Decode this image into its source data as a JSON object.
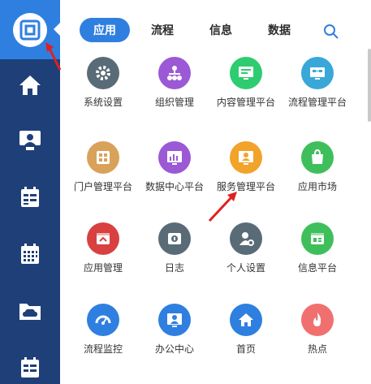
{
  "tabs": [
    {
      "label": "应用",
      "active": true
    },
    {
      "label": "流程",
      "active": false
    },
    {
      "label": "信息",
      "active": false
    },
    {
      "label": "数据",
      "active": false
    }
  ],
  "apps": [
    {
      "label": "系统设置",
      "color": "#5a6b78",
      "icon": "gear-icon"
    },
    {
      "label": "组织管理",
      "color": "#9b59d6",
      "icon": "org-chart-icon"
    },
    {
      "label": "内容管理平台",
      "color": "#2ecc71",
      "icon": "monitor-icon"
    },
    {
      "label": "流程管理平台",
      "color": "#3aa7d9",
      "icon": "flow-icon"
    },
    {
      "label": "门户管理平台",
      "color": "#d9a25b",
      "icon": "grid-icon"
    },
    {
      "label": "数据中心平台",
      "color": "#9b59d6",
      "icon": "bar-chart-icon"
    },
    {
      "label": "服务管理平台",
      "color": "#f2a32a",
      "icon": "service-icon"
    },
    {
      "label": "应用市场",
      "color": "#3fbf5b",
      "icon": "shopping-bag-icon"
    },
    {
      "label": "应用管理",
      "color": "#d94040",
      "icon": "app-window-icon"
    },
    {
      "label": "日志",
      "color": "#5a6b78",
      "icon": "log-icon"
    },
    {
      "label": "个人设置",
      "color": "#5a6b78",
      "icon": "user-settings-icon"
    },
    {
      "label": "信息平台",
      "color": "#3fbf5b",
      "icon": "info-window-icon"
    },
    {
      "label": "流程监控",
      "color": "#2f7fe0",
      "icon": "gauge-icon"
    },
    {
      "label": "办公中心",
      "color": "#2f7fe0",
      "icon": "office-user-icon"
    },
    {
      "label": "首页",
      "color": "#2f7fe0",
      "icon": "home-icon"
    },
    {
      "label": "热点",
      "color": "#f07070",
      "icon": "fire-icon"
    }
  ],
  "sidebar": {
    "items": [
      "logo-icon",
      "home-icon",
      "user-monitor-icon",
      "calendar-list-icon",
      "calendar-grid-icon",
      "cloud-folder-icon",
      "notes-icon"
    ]
  },
  "colors": {
    "accent": "#2f7fe0",
    "sidebar_bg": "#1f3f78",
    "annotation_arrow": "#e02020"
  }
}
